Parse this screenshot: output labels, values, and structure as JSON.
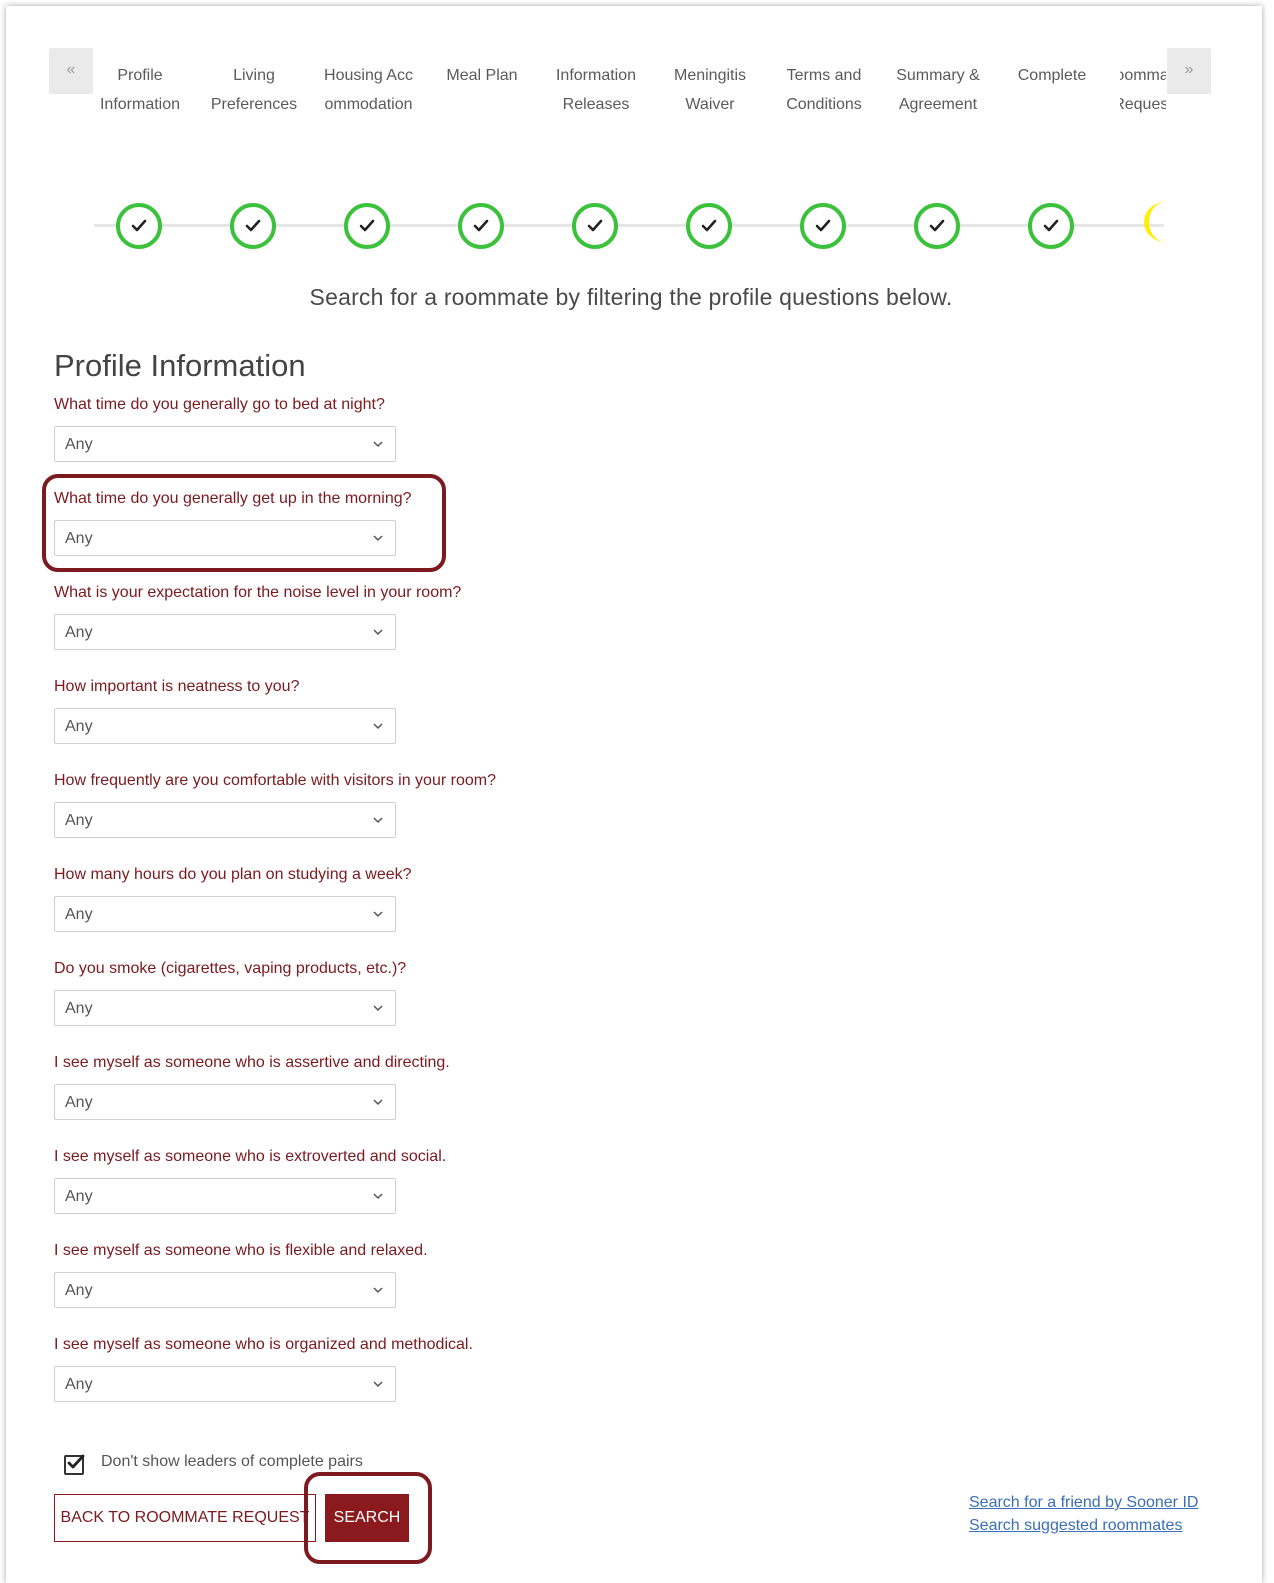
{
  "steps": [
    {
      "label": "Profile Information",
      "status": "complete"
    },
    {
      "label": "Living Preferences",
      "status": "complete"
    },
    {
      "label": "Housing Accommodation",
      "status": "complete"
    },
    {
      "label": "Meal Plan",
      "status": "complete"
    },
    {
      "label": "Information Releases",
      "status": "complete"
    },
    {
      "label": "Meningitis Waiver",
      "status": "complete"
    },
    {
      "label": "Terms and Conditions",
      "status": "complete"
    },
    {
      "label": "Summary & Agreement",
      "status": "complete"
    },
    {
      "label": "Complete",
      "status": "complete"
    },
    {
      "label": "Roommate Request",
      "status": "current"
    }
  ],
  "nav": {
    "prev_icon": "«",
    "next_icon": "»"
  },
  "subtitle": "Search for a roommate by filtering the profile questions below.",
  "section_title": "Profile Information",
  "questions": [
    {
      "label": "What time do you generally go to bed at night?",
      "value": "Any"
    },
    {
      "label": "What time do you generally get up in the morning?",
      "value": "Any"
    },
    {
      "label": "What is your expectation for the noise level in your room?",
      "value": "Any"
    },
    {
      "label": "How important is neatness to you?",
      "value": "Any"
    },
    {
      "label": "How frequently are you comfortable with visitors in your room?",
      "value": "Any"
    },
    {
      "label": "How many hours do you plan on studying a week?",
      "value": "Any"
    },
    {
      "label": "Do you smoke (cigarettes, vaping products, etc.)?",
      "value": "Any"
    },
    {
      "label": "I see myself as someone who is assertive and directing.",
      "value": "Any"
    },
    {
      "label": "I see myself as someone who is extroverted and social.",
      "value": "Any"
    },
    {
      "label": "I see myself as someone who is flexible and relaxed.",
      "value": "Any"
    },
    {
      "label": "I see myself as someone who is organized and methodical.",
      "value": "Any"
    }
  ],
  "checkbox": {
    "label": "Don't show leaders of complete pairs",
    "checked": true
  },
  "buttons": {
    "back": "BACK TO ROOMMATE REQUEST",
    "search": "SEARCH"
  },
  "links": {
    "friend": "Search for a friend by Sooner ID",
    "suggested": "Search suggested roommates"
  },
  "colors": {
    "accent": "#8b1a1f",
    "complete": "#3cc13c",
    "current": "#ffee00",
    "link": "#3b6fb6"
  }
}
